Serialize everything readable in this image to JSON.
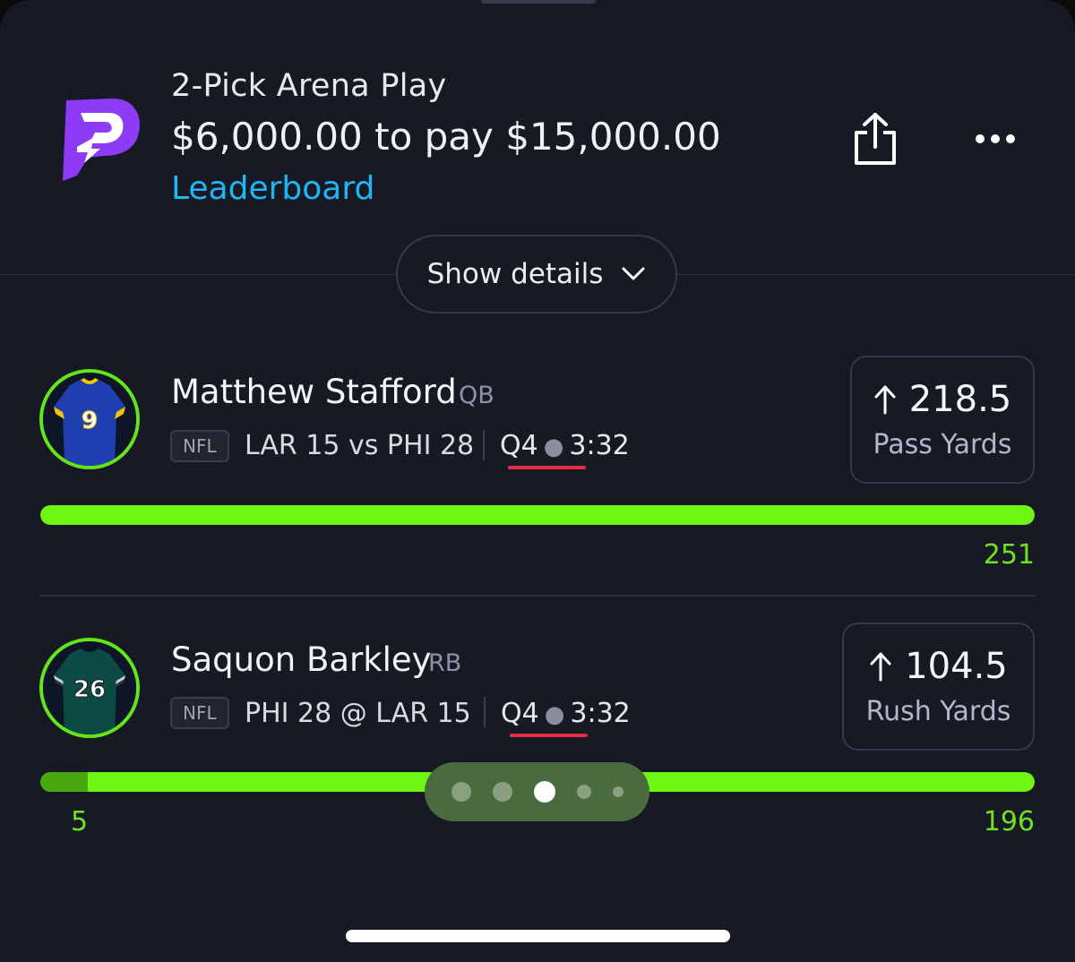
{
  "header": {
    "title": "2-Pick Arena Play",
    "subtitle": "$6,000.00 to pay $15,000.00",
    "leaderboard_label": "Leaderboard",
    "logo_icon": "prizepicks-p-logo",
    "share_icon": "share-icon",
    "more_icon": "more-dots-icon"
  },
  "details_button": {
    "label": "Show details",
    "icon": "chevron-down-icon"
  },
  "picks": [
    {
      "player": "Matthew Stafford",
      "position": "QB",
      "league": "NFL",
      "game": "LAR 15 vs PHI 28",
      "quarter": "Q4",
      "clock": "3:32",
      "line_value": "218.5",
      "stat": "Pass Yards",
      "direction": "more",
      "current_value": "251",
      "progress": 1.0,
      "jersey_number": "9",
      "jersey_color": "#1f3fb0"
    },
    {
      "player": "Saquon Barkley",
      "position": "RB",
      "league": "NFL",
      "game": "PHI 28 @ LAR 15",
      "quarter": "Q4",
      "clock": "3:32",
      "line_value": "104.5",
      "stat": "Rush Yards",
      "direction": "more",
      "start_value": "5",
      "current_value": "196",
      "progress": 1.0,
      "jersey_number": "26",
      "jersey_color": "#0d4a44"
    }
  ],
  "pager": {
    "count": 5,
    "active_index": 2
  },
  "colors": {
    "accent_green": "#6ef514",
    "link_blue": "#1fb6f3",
    "live_red": "#ea2b45",
    "background": "#171a25"
  }
}
